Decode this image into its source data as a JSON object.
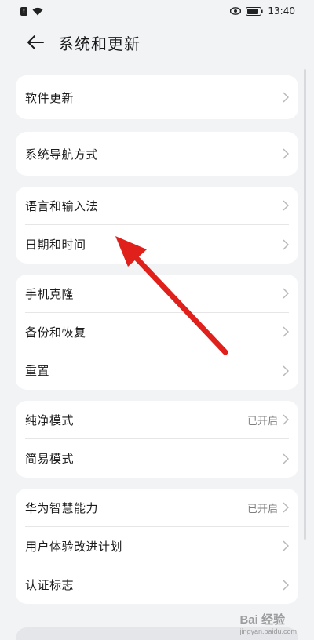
{
  "status_bar": {
    "time": "13:40",
    "notification_badge": "!"
  },
  "header": {
    "title": "系统和更新"
  },
  "groups": [
    {
      "items": [
        {
          "label": "软件更新",
          "value": ""
        }
      ]
    },
    {
      "items": [
        {
          "label": "系统导航方式",
          "value": ""
        }
      ]
    },
    {
      "items": [
        {
          "label": "语言和输入法",
          "value": ""
        },
        {
          "label": "日期和时间",
          "value": ""
        }
      ]
    },
    {
      "items": [
        {
          "label": "手机克隆",
          "value": ""
        },
        {
          "label": "备份和恢复",
          "value": ""
        },
        {
          "label": "重置",
          "value": ""
        }
      ]
    },
    {
      "items": [
        {
          "label": "纯净模式",
          "value": "已开启"
        },
        {
          "label": "简易模式",
          "value": ""
        }
      ]
    },
    {
      "items": [
        {
          "label": "华为智慧能力",
          "value": "已开启"
        },
        {
          "label": "用户体验改进计划",
          "value": ""
        },
        {
          "label": "认证标志",
          "value": ""
        }
      ]
    }
  ],
  "watermark": {
    "text": "Bai 经验",
    "url": "jingyan.baidu.com"
  },
  "colors": {
    "arrow": "#e0201b",
    "background": "#f1f3f5",
    "card": "#ffffff"
  }
}
